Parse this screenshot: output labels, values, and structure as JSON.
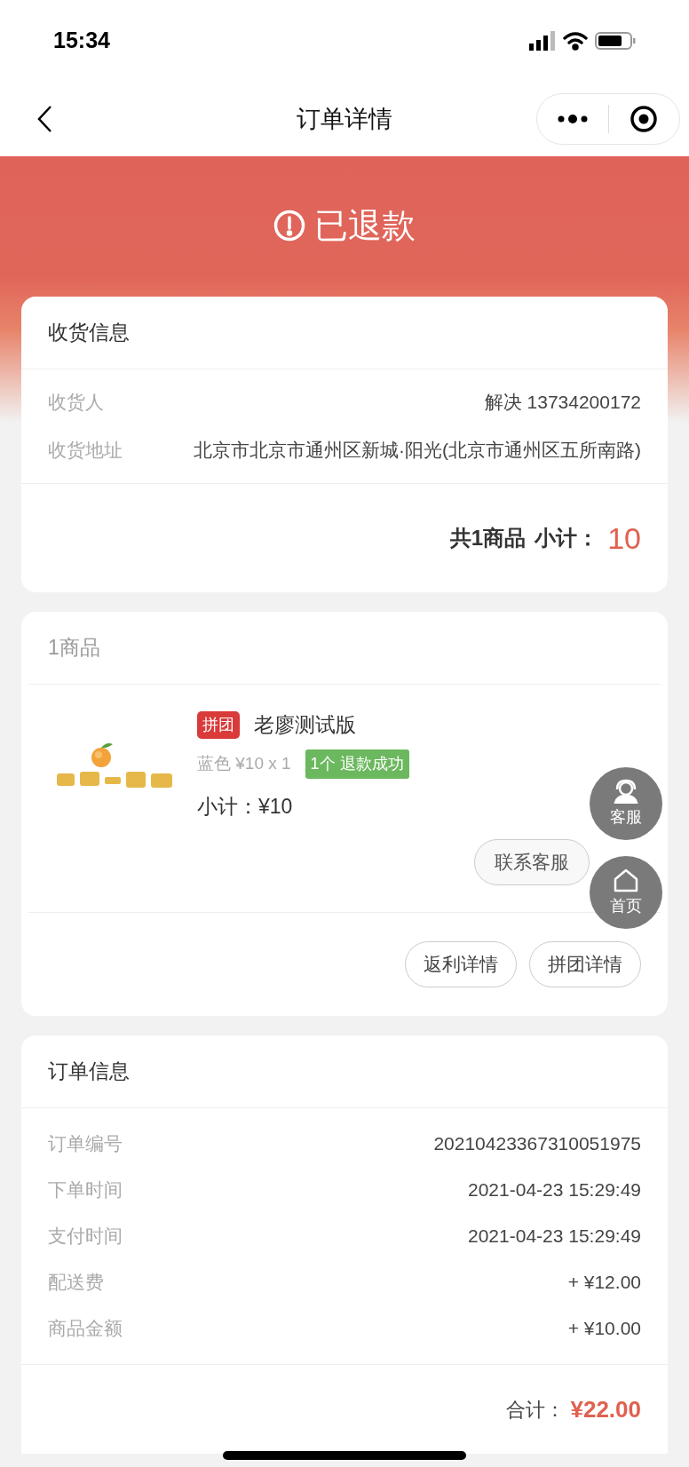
{
  "status_bar": {
    "time": "15:34"
  },
  "nav": {
    "title": "订单详情"
  },
  "banner": {
    "status": "已退款"
  },
  "receiver_card": {
    "title": "收货信息",
    "rows": [
      {
        "label": "收货人",
        "value": "解决 13734200172"
      },
      {
        "label": "收货地址",
        "value": "北京市北京市通州区新城·阳光(北京市通州区五所南路)"
      }
    ],
    "summary": {
      "count": "共1商品",
      "subtotal_label": "小计：",
      "subtotal": "10"
    }
  },
  "goods_card": {
    "title": "1商品",
    "items": [
      {
        "tag": "拼团",
        "name": "老廖测试版",
        "spec": "蓝色 ¥10 x 1",
        "refund_badge": "1个 退款成功",
        "subtotal": "小计：¥10",
        "action": "联系客服"
      }
    ],
    "buttons": [
      "返利详情",
      "拼团详情"
    ]
  },
  "order_card": {
    "title": "订单信息",
    "rows": [
      {
        "label": "订单编号",
        "value": "20210423367310051975"
      },
      {
        "label": "下单时间",
        "value": "2021-04-23 15:29:49"
      },
      {
        "label": "支付时间",
        "value": "2021-04-23 15:29:49"
      },
      {
        "label": "配送费",
        "value": "+ ¥12.00"
      },
      {
        "label": "商品金额",
        "value": "+ ¥10.00"
      }
    ],
    "total_label": "合计：",
    "total": "¥22.00"
  },
  "float_buttons": [
    {
      "kind": "service",
      "label": "客服"
    },
    {
      "kind": "home",
      "label": "首页"
    }
  ]
}
